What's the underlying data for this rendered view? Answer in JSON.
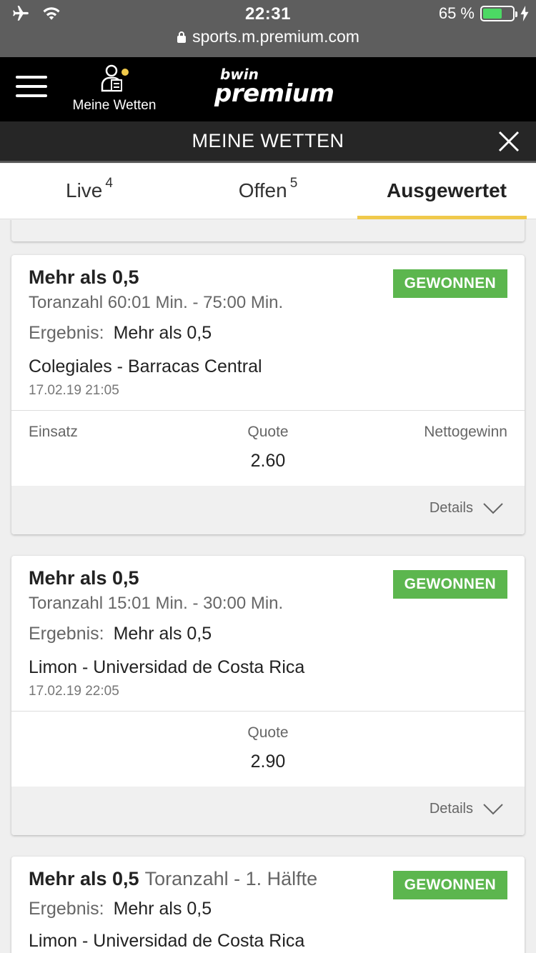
{
  "status_bar": {
    "time": "22:31",
    "battery_percent": "65 %",
    "battery_level": 0.65,
    "url": "sports.m.premium.com"
  },
  "header": {
    "mybets_label": "Meine Wetten",
    "logo_top": "bwin",
    "logo_main": "premium"
  },
  "section": {
    "title": "MEINE WETTEN"
  },
  "tabs": [
    {
      "label": "Live",
      "count": "4"
    },
    {
      "label": "Offen",
      "count": "5"
    },
    {
      "label": "Ausgewertet",
      "count": ""
    }
  ],
  "details_label": "Details",
  "bets": [
    {
      "title": "Mehr als 0,5",
      "subtitle": "",
      "market": "Toranzahl 60:01 Min. - 75:00 Min.",
      "status": "GEWONNEN",
      "result_label": "Ergebnis:",
      "result_value": "Mehr als 0,5",
      "match": "Colegiales - Barracas Central",
      "date": "17.02.19 21:05",
      "stake_label": "Einsatz",
      "odds_label": "Quote",
      "odds_value": "2.60",
      "net_label": "Nettogewinn"
    },
    {
      "title": "Mehr als 0,5",
      "subtitle": "",
      "market": "Toranzahl 15:01 Min. - 30:00 Min.",
      "status": "GEWONNEN",
      "result_label": "Ergebnis:",
      "result_value": "Mehr als 0,5",
      "match": "Limon - Universidad de Costa Rica",
      "date": "17.02.19 22:05",
      "stake_label": "",
      "odds_label": "Quote",
      "odds_value": "2.90",
      "net_label": ""
    },
    {
      "title": "Mehr als 0,5",
      "subtitle": "Toranzahl - 1. Hälfte",
      "market": "",
      "status": "GEWONNEN",
      "result_label": "Ergebnis:",
      "result_value": "Mehr als 0,5",
      "match": "Limon - Universidad de Costa Rica",
      "date": "",
      "stake_label": "",
      "odds_label": "",
      "odds_value": "",
      "net_label": ""
    }
  ]
}
